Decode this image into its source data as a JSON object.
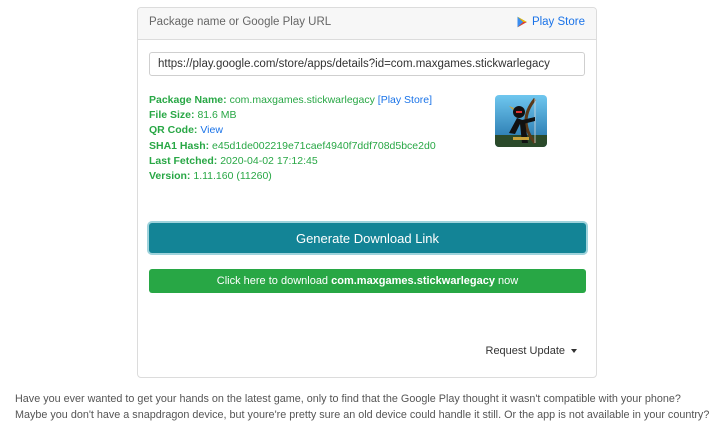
{
  "header": {
    "label": "Package name or Google Play URL",
    "play_store_link": "Play Store",
    "play_icon": "play-triangle-icon"
  },
  "url_input": {
    "value": "https://play.google.com/store/apps/details?id=com.maxgames.stickwarlegacy"
  },
  "info": {
    "package_name_label": "Package Name:",
    "package_name": "com.maxgames.stickwarlegacy",
    "package_link": "[Play Store]",
    "file_size_label": "File Size:",
    "file_size": "81.6 MB",
    "qr_label": "QR Code:",
    "qr_link": "View",
    "sha1_label": "SHA1 Hash:",
    "sha1": "e45d1de002219e71caef4940f7ddf708d5bce2d0",
    "fetched_label": "Last Fetched:",
    "fetched": "2020-04-02 17:12:45",
    "version_label": "Version:",
    "version": "1.11.160 (11260)"
  },
  "buttons": {
    "generate": "Generate Download Link",
    "download_prefix": "Click here to download ",
    "download_package": "com.maxgames.stickwarlegacy",
    "download_suffix": " now",
    "request_update": "Request Update"
  },
  "description": {
    "line1": "Have you ever wanted to get your hands on the latest game, only to find that the Google Play thought it wasn't compatible with your phone?",
    "line2": "Maybe you don't have a snapdragon device, but youre're pretty sure an old device could handle it still. Or the app is not available in your country?"
  },
  "colors": {
    "green": "#28a745",
    "teal": "#138496",
    "link_blue": "#1a73e8"
  }
}
